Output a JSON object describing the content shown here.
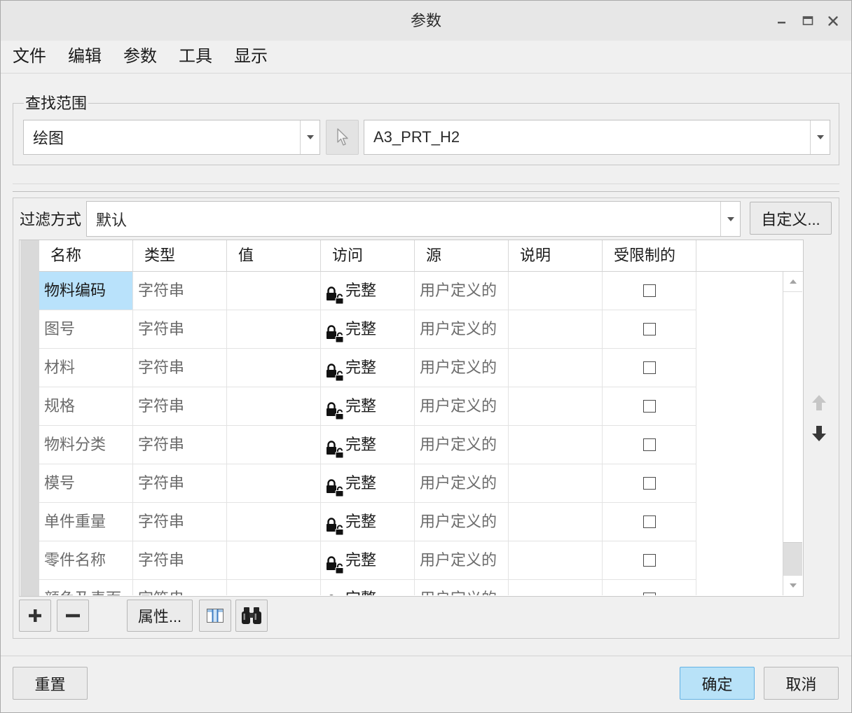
{
  "window": {
    "title": "参数"
  },
  "menu": {
    "items": [
      "文件",
      "编辑",
      "参数",
      "工具",
      "显示"
    ]
  },
  "scope": {
    "legend": "查找范围",
    "look_in": "绘图",
    "model": "A3_PRT_H2"
  },
  "filter": {
    "label": "过滤方式",
    "value": "默认",
    "customize_label": "自定义..."
  },
  "table": {
    "columns": [
      "名称",
      "类型",
      "值",
      "访问",
      "源",
      "说明",
      "受限制的"
    ],
    "rows": [
      {
        "name": "物料编码",
        "type": "字符串",
        "value": "",
        "access": "完整",
        "source": "用户定义的",
        "description": "",
        "restricted": false,
        "selected": true
      },
      {
        "name": "图号",
        "type": "字符串",
        "value": "",
        "access": "完整",
        "source": "用户定义的",
        "description": "",
        "restricted": false,
        "selected": false
      },
      {
        "name": "材料",
        "type": "字符串",
        "value": "",
        "access": "完整",
        "source": "用户定义的",
        "description": "",
        "restricted": false,
        "selected": false
      },
      {
        "name": "规格",
        "type": "字符串",
        "value": "",
        "access": "完整",
        "source": "用户定义的",
        "description": "",
        "restricted": false,
        "selected": false
      },
      {
        "name": "物料分类",
        "type": "字符串",
        "value": "",
        "access": "完整",
        "source": "用户定义的",
        "description": "",
        "restricted": false,
        "selected": false
      },
      {
        "name": "模号",
        "type": "字符串",
        "value": "",
        "access": "完整",
        "source": "用户定义的",
        "description": "",
        "restricted": false,
        "selected": false
      },
      {
        "name": "单件重量",
        "type": "字符串",
        "value": "",
        "access": "完整",
        "source": "用户定义的",
        "description": "",
        "restricted": false,
        "selected": false
      },
      {
        "name": "零件名称",
        "type": "字符串",
        "value": "",
        "access": "完整",
        "source": "用户定义的",
        "description": "",
        "restricted": false,
        "selected": false
      },
      {
        "name": "颜色及表面",
        "type": "字符串",
        "value": "",
        "access": "完整",
        "source": "用户定义的",
        "description": "",
        "restricted": false,
        "selected": false
      }
    ]
  },
  "toolbar": {
    "properties_label": "属性..."
  },
  "footer": {
    "reset_label": "重置",
    "ok_label": "确定",
    "cancel_label": "取消"
  },
  "icons": {
    "window_controls": [
      "minimize-icon",
      "maximize-icon",
      "close-icon"
    ],
    "pick_from_model": "pointer-icon",
    "dropdown": "chevron-down-icon",
    "access": "lock-icon",
    "move_up": "arrow-up-icon",
    "move_down": "arrow-down-icon",
    "add": "plus-icon",
    "remove": "minus-icon",
    "columns": "table-columns-icon",
    "find": "binoculars-icon"
  },
  "colors": {
    "selection": "#b9e2fb",
    "ok_button": "#b8e2f8",
    "ok_button_border": "#63b2e4"
  }
}
